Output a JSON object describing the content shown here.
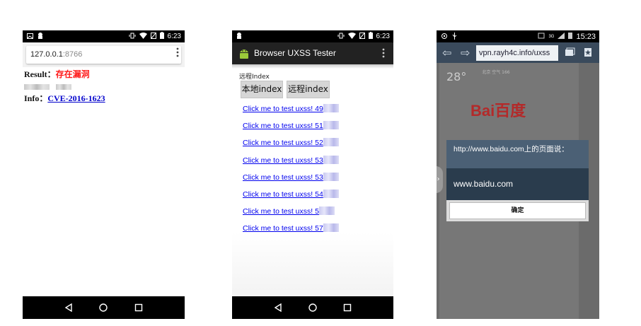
{
  "phone1": {
    "status_time": "6:23",
    "address": "127.0.0.1",
    "address_port": ":8766",
    "result_label": "Result：",
    "result_value": "存在漏洞",
    "info_label": "Info：",
    "info_link": "CVE-2016-1623"
  },
  "phone2": {
    "status_time": "6:23",
    "app_title": "Browser UXSS Tester",
    "section_label": "远程Index",
    "buttons": [
      "本地index",
      "远程index"
    ],
    "links": [
      "Click me to test uxss! 49",
      "Click me to test uxss! 51",
      "Click me to test uxss! 52",
      "Click me to test uxss! 53",
      "Click me to test uxss! 53",
      "Click me to test uxss! 54",
      "Click me to test uxss! 5",
      "Click me to test uxss! 57"
    ]
  },
  "phone3": {
    "status_time": "15:23",
    "status_network": "3G",
    "url": "vpn.rayh4c.info/uxss",
    "temperature": "28°",
    "weather_small": "北京\n空气 166",
    "logo_text": "Bai百度",
    "dialog_title": "http://www.baidu.com上的页面说：",
    "dialog_message": "www.baidu.com",
    "dialog_ok": "确定"
  },
  "colors": {
    "red_text": "#ff1a1a",
    "link_blue": "#0000ee",
    "dialog_bg": "#3b5063",
    "action_bar": "#222222"
  }
}
